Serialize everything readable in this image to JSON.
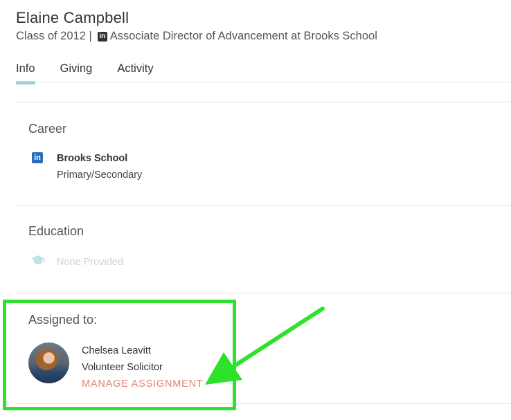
{
  "profile": {
    "name": "Elaine Campbell",
    "class_label": "Class of 2012 |",
    "linkedin_badge": "in",
    "headline": "Associate Director of Advancement at Brooks School"
  },
  "tabs": [
    {
      "label": "Info",
      "active": true
    },
    {
      "label": "Giving",
      "active": false
    },
    {
      "label": "Activity",
      "active": false
    }
  ],
  "career": {
    "title": "Career",
    "icon": "linkedin-icon",
    "icon_text": "in",
    "organization": "Brooks School",
    "type": "Primary/Secondary"
  },
  "education": {
    "title": "Education",
    "icon": "graduation-cap-icon",
    "value": "None Provided"
  },
  "assigned": {
    "title": "Assigned to:",
    "name": "Chelsea Leavitt",
    "role": "Volunteer Solicitor",
    "manage_label": "MANAGE ASSIGNMENT"
  },
  "colors": {
    "tab_underline": "#8fd1d1",
    "linkedin_blue": "#2a6ebb",
    "manage_link": "#e0857a",
    "annotation_green": "#2ee22b"
  }
}
